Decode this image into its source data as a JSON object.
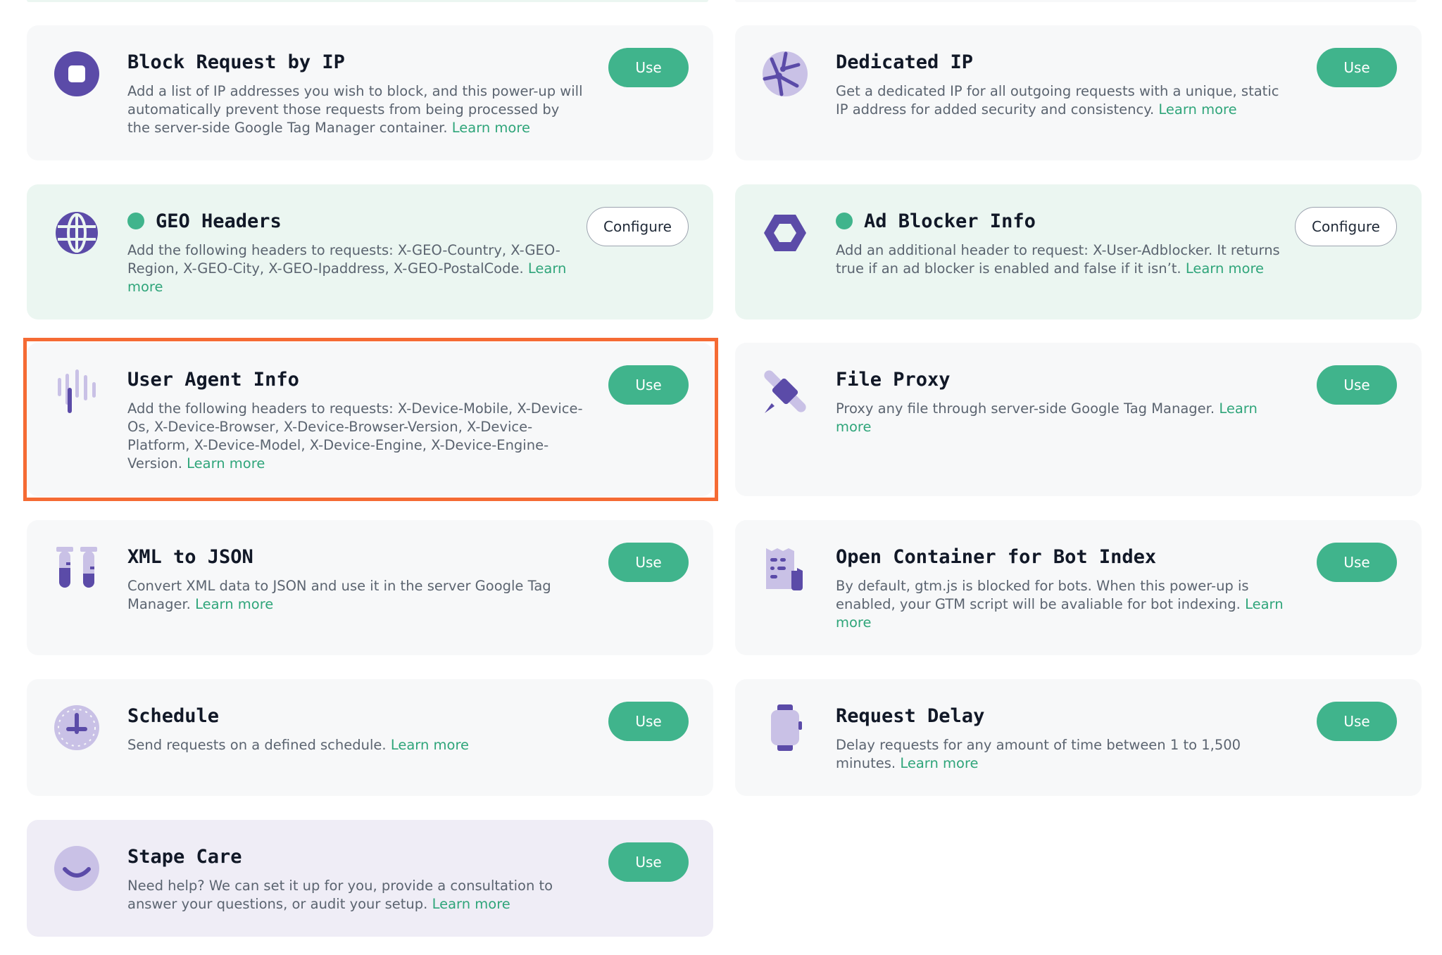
{
  "colors": {
    "accent_green": "#40b48c",
    "link_green": "#2fa57a",
    "icon_purple": "#5b4ba8",
    "icon_light_purple": "#c9c1e6",
    "active_card_bg": "#ebf6f1",
    "default_card_bg": "#f7f8f9",
    "care_card_bg": "#efedf6",
    "highlight_orange": "#f56b34"
  },
  "cards": [
    {
      "title": "Block Request by IP",
      "icon": "block-stop-icon",
      "description": "Add a list of IP addresses you wish to block, and this power-up will automatically prevent those requests from being processed by the server-side Google Tag Manager container.",
      "link": "Learn more",
      "button": "Use",
      "status": "default"
    },
    {
      "title": "Dedicated IP",
      "icon": "network-globe-icon",
      "description": "Get a dedicated IP for all outgoing requests with a unique, static IP address for added security and consistency.",
      "link": "Learn more",
      "button": "Use",
      "status": "default"
    },
    {
      "title": "GEO Headers",
      "icon": "globe-icon",
      "description": "Add the following headers to requests: X-GEO-Country, X-GEO-Region, X-GEO-City, X-GEO-Ipaddress, X-GEO-PostalCode.",
      "link": "Learn more",
      "button": "Configure",
      "status": "active"
    },
    {
      "title": "Ad Blocker Info",
      "icon": "hexagon-icon",
      "description": "Add an additional header to request: X-User-Adblocker. It returns true if an ad blocker is enabled and false if it isn’t.",
      "link": "Learn more",
      "button": "Configure",
      "status": "active"
    },
    {
      "title": "User Agent Info",
      "icon": "signal-bars-icon",
      "description": "Add the following headers to requests: X-Device-Mobile, X-Device-Os, X-Device-Browser, X-Device-Browser-Version, X-Device-Platform, X-Device-Model, X-Device-Engine, X-Device-Engine-Version.",
      "link": "Learn more",
      "button": "Use",
      "status": "default",
      "highlighted": true
    },
    {
      "title": "File Proxy",
      "icon": "satellite-icon",
      "description": "Proxy any file through server-side Google Tag Manager.",
      "link": "Learn more",
      "button": "Use",
      "status": "default"
    },
    {
      "title": "XML to JSON",
      "icon": "test-tubes-icon",
      "description": "Convert XML data to JSON and use it in the server Google Tag Manager.",
      "link": "Learn more",
      "button": "Use",
      "status": "default"
    },
    {
      "title": "Open Container for Bot Index",
      "icon": "document-bot-icon",
      "description": "By default, gtm.js is blocked for bots. When this power-up is enabled, your GTM script will be avaliable for bot indexing.",
      "link": "Learn more",
      "button": "Use",
      "status": "default"
    },
    {
      "title": "Schedule",
      "icon": "clock-icon",
      "description": "Send requests on a defined schedule.",
      "link": "Learn more",
      "button": "Use",
      "status": "default"
    },
    {
      "title": "Request Delay",
      "icon": "watch-icon",
      "description": "Delay requests for any amount of time between 1 to 1,500 minutes.",
      "link": "Learn more",
      "button": "Use",
      "status": "default"
    },
    {
      "title": "Stape Care",
      "icon": "smile-icon",
      "description": "Need help? We can set it up for you, provide a consultation to answer your questions, or audit your setup.",
      "link": "Learn more",
      "button": "Use",
      "status": "care"
    }
  ]
}
